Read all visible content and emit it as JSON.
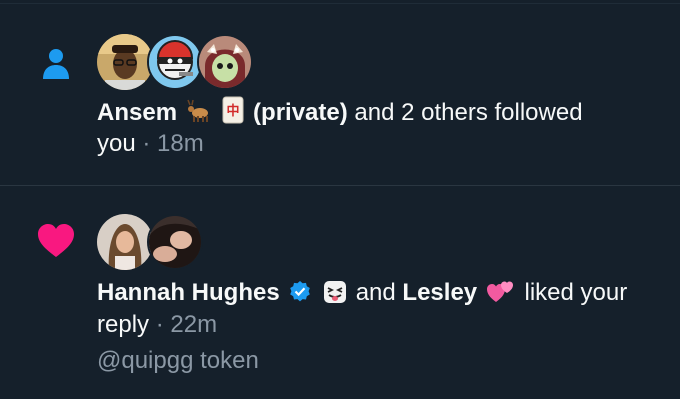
{
  "notifications": [
    {
      "type": "follow",
      "icon": "person-icon",
      "icon_color": "#1d9bf0",
      "actor_name": "Ansem",
      "actor_emoji_1": "goat",
      "actor_emoji_2": "mahjong-red-dragon",
      "private_label": "(private)",
      "action_text": "and 2 others followed",
      "action_text_2": "you",
      "separator": "·",
      "time": "18m",
      "avatars": [
        "avatar-man-glasses",
        "avatar-cartoon-helmet",
        "avatar-anime-girl"
      ]
    },
    {
      "type": "like",
      "icon": "heart-icon",
      "icon_color": "#f91880",
      "actor_name": "Hannah Hughes",
      "verified": true,
      "actor_emoji": "face-with-tongue-squinting",
      "connector": "and",
      "actor_name_2": "Lesley",
      "actor_2_emoji": "two-hearts",
      "action_text": "liked your",
      "action_text_2": "reply",
      "separator": "·",
      "time": "22m",
      "quoted_text": "@quipgg token",
      "avatars": [
        "avatar-woman-selfie",
        "avatar-woman-dark-hair"
      ]
    }
  ],
  "colors": {
    "background": "#15202b",
    "text": "#f7f9f9",
    "muted": "#8b98a5",
    "verified": "#1d9bf0"
  }
}
